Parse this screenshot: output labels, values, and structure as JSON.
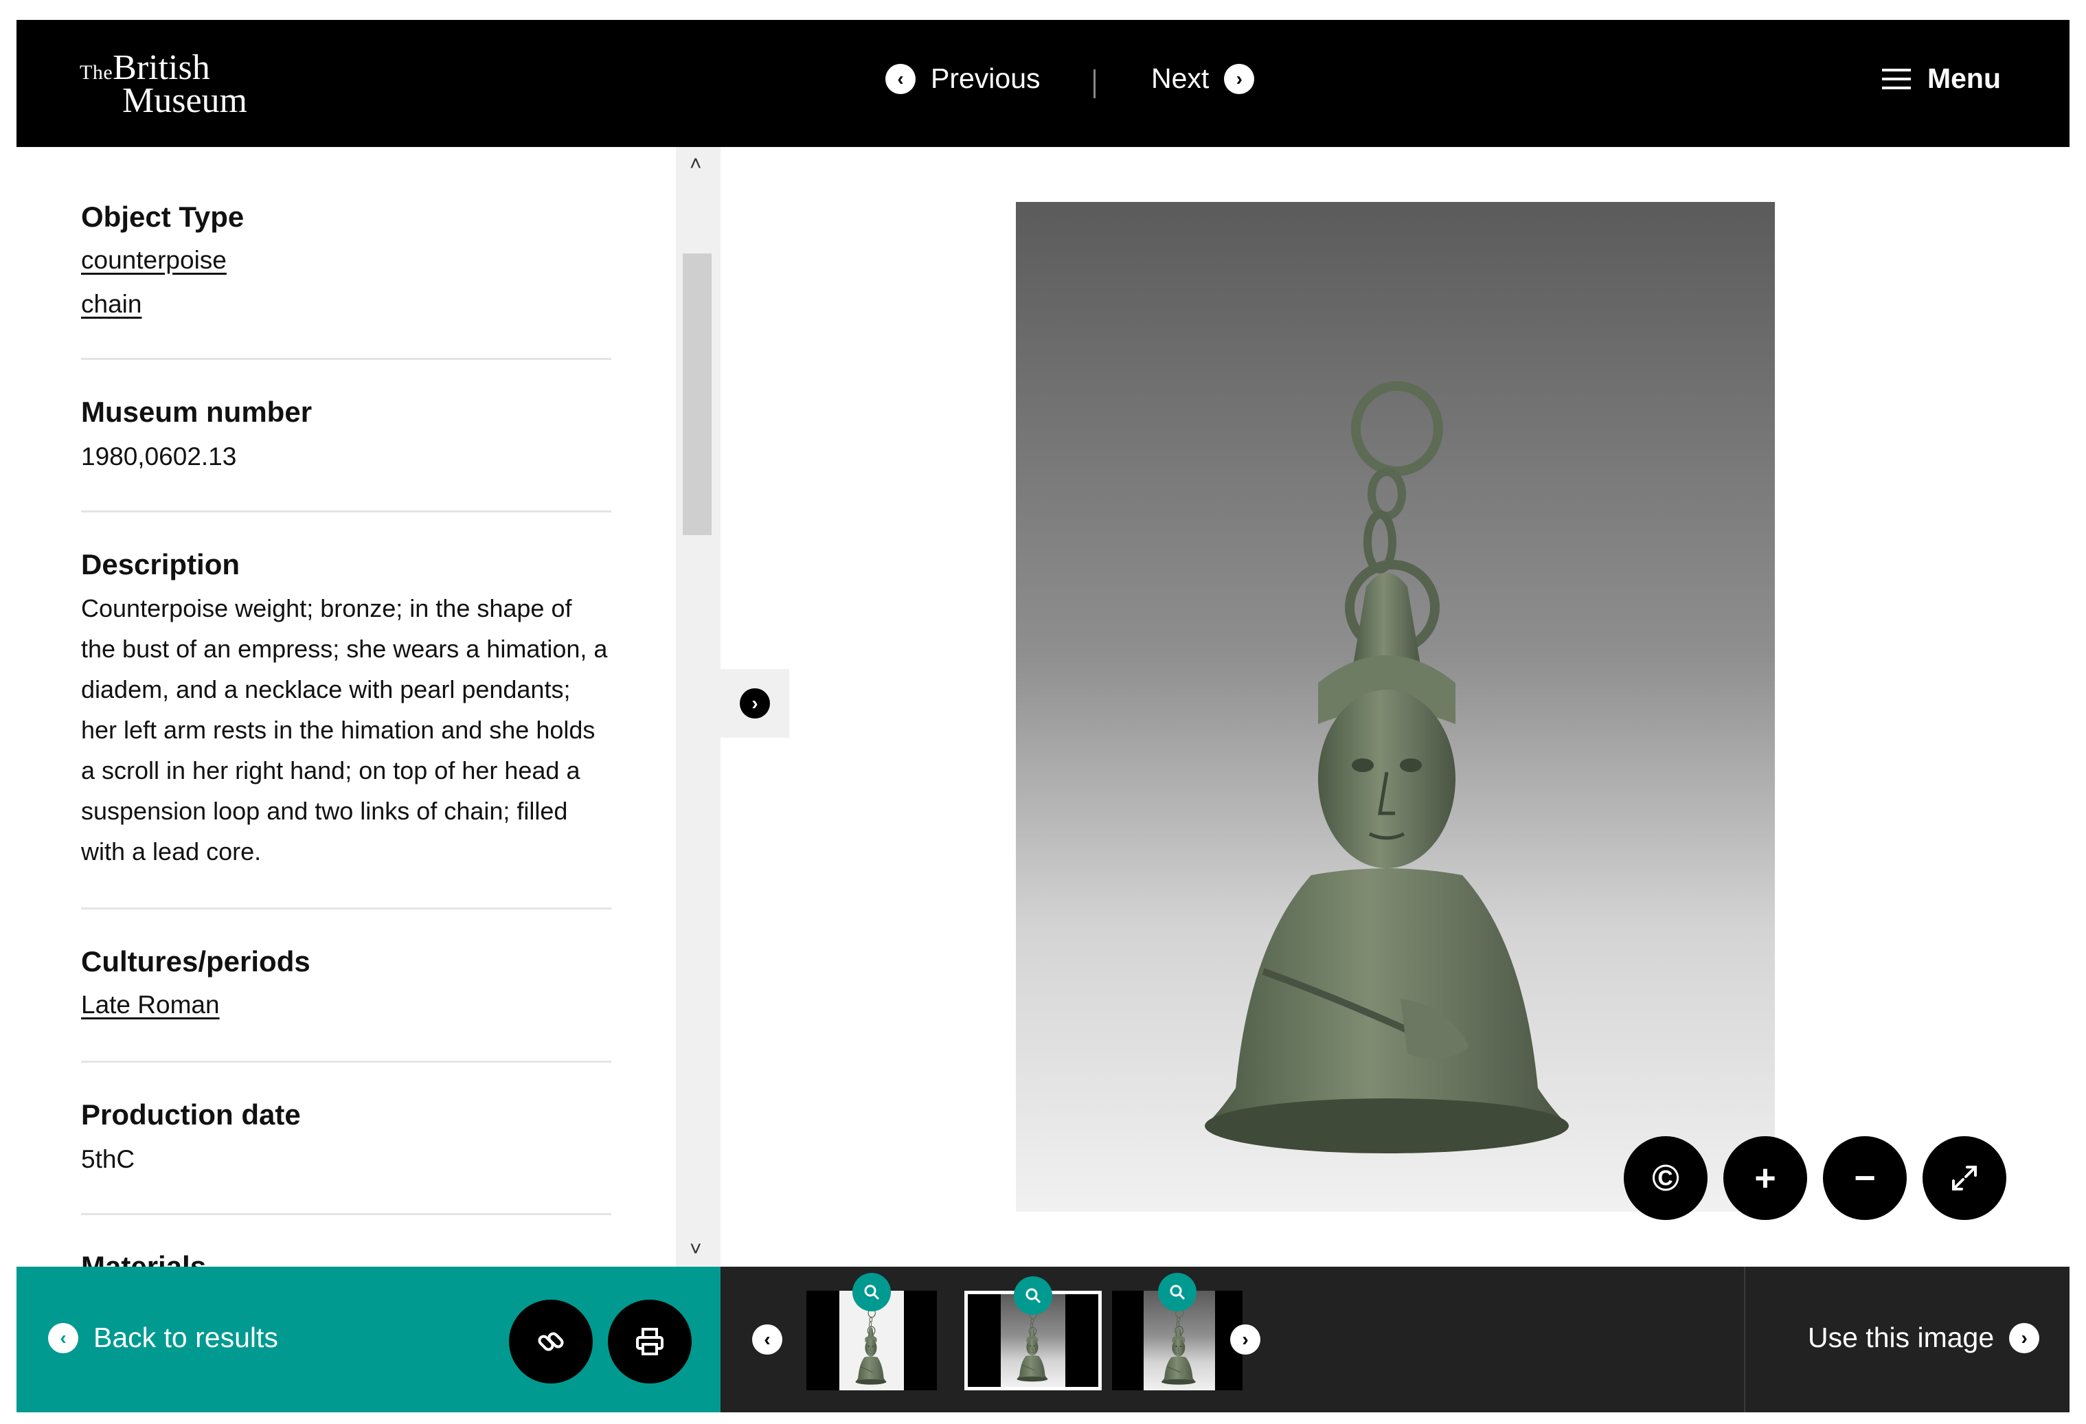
{
  "header": {
    "logo_the": "The",
    "logo_line1": "British",
    "logo_line2": "Museum",
    "prev_label": "Previous",
    "next_label": "Next",
    "menu_label": "Menu"
  },
  "details": {
    "object_type": {
      "title": "Object Type",
      "links": [
        "counterpoise",
        "chain"
      ]
    },
    "museum_number": {
      "title": "Museum number",
      "value": "1980,0602.13"
    },
    "description": {
      "title": "Description",
      "text": "Counterpoise weight; bronze; in the shape of the bust of an empress; she wears a himation, a diadem, and a necklace with pearl pendants; her left arm rests in the himation and she holds a scroll in her right hand; on top of her head a suspension loop and two links of chain; filled with a lead core."
    },
    "cultures": {
      "title": "Cultures/periods",
      "links": [
        "Late Roman"
      ]
    },
    "production_date": {
      "title": "Production date",
      "value": "5thC"
    },
    "materials": {
      "title": "Materials"
    }
  },
  "viewer": {
    "controls": {
      "copyright_symbol": "©",
      "zoom_in_symbol": "+",
      "zoom_out_symbol": "−"
    }
  },
  "footer": {
    "back_label": "Back to results",
    "use_image_label": "Use this image",
    "thumbnails_count": 3,
    "selected_thumbnail": 2
  },
  "colors": {
    "header_bg": "#000000",
    "accent_teal": "#009a90",
    "filmstrip_bg": "#222222"
  },
  "icons": {
    "nav_prev": "chevron-left-circle-icon",
    "nav_next": "chevron-right-circle-icon",
    "menu": "hamburger-icon",
    "copyright": "copyright-icon",
    "zoom_in": "plus-icon",
    "zoom_out": "minus-icon",
    "fullscreen": "expand-icon",
    "link": "link-icon",
    "print": "printer-icon",
    "thumb_badge": "magnifier-icon"
  }
}
